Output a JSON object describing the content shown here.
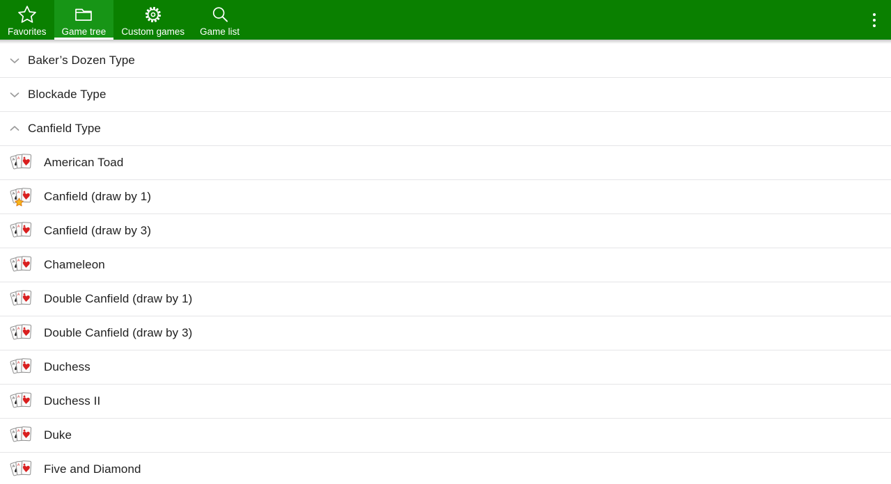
{
  "appbar": {
    "background_color": "#0a8000",
    "active_tab_color": "#179516",
    "tabs": [
      {
        "label": "Favorites",
        "icon": "star-icon",
        "active": false
      },
      {
        "label": "Game tree",
        "icon": "folder-icon",
        "active": true
      },
      {
        "label": "Custom games",
        "icon": "gear-icon",
        "active": false
      },
      {
        "label": "Game list",
        "icon": "search-icon",
        "active": false
      }
    ],
    "overflow_menu": {
      "icon": "more-vert-icon",
      "label": "More options"
    }
  },
  "list": {
    "rows": [
      {
        "type": "group",
        "label": "Baker’s Dozen Type",
        "expanded": false,
        "icon": "chevron-down-icon"
      },
      {
        "type": "group",
        "label": "Blockade Type",
        "expanded": false,
        "icon": "chevron-down-icon"
      },
      {
        "type": "group",
        "label": "Canfield Type",
        "expanded": true,
        "icon": "chevron-up-icon"
      },
      {
        "type": "game",
        "label": "American Toad",
        "icon": "playing-cards-icon",
        "favorite": false
      },
      {
        "type": "game",
        "label": "Canfield (draw by 1)",
        "icon": "playing-cards-icon",
        "favorite": true
      },
      {
        "type": "game",
        "label": "Canfield (draw by 3)",
        "icon": "playing-cards-icon",
        "favorite": false
      },
      {
        "type": "game",
        "label": "Chameleon",
        "icon": "playing-cards-icon",
        "favorite": false
      },
      {
        "type": "game",
        "label": "Double Canfield (draw by 1)",
        "icon": "playing-cards-icon",
        "favorite": false
      },
      {
        "type": "game",
        "label": "Double Canfield (draw by 3)",
        "icon": "playing-cards-icon",
        "favorite": false
      },
      {
        "type": "game",
        "label": "Duchess",
        "icon": "playing-cards-icon",
        "favorite": false
      },
      {
        "type": "game",
        "label": "Duchess II",
        "icon": "playing-cards-icon",
        "favorite": false
      },
      {
        "type": "game",
        "label": "Duke",
        "icon": "playing-cards-icon",
        "favorite": false
      },
      {
        "type": "game",
        "label": "Five and Diamond",
        "icon": "playing-cards-icon",
        "favorite": false
      }
    ]
  },
  "colors": {
    "brand_green": "#0a8000",
    "active_green": "#179516",
    "divider": "#e5e5e7",
    "text": "#1f1f1f",
    "chevron": "#9a9a9a",
    "heart_red": "#d91f1f",
    "star_gold": "#f5b81c"
  }
}
